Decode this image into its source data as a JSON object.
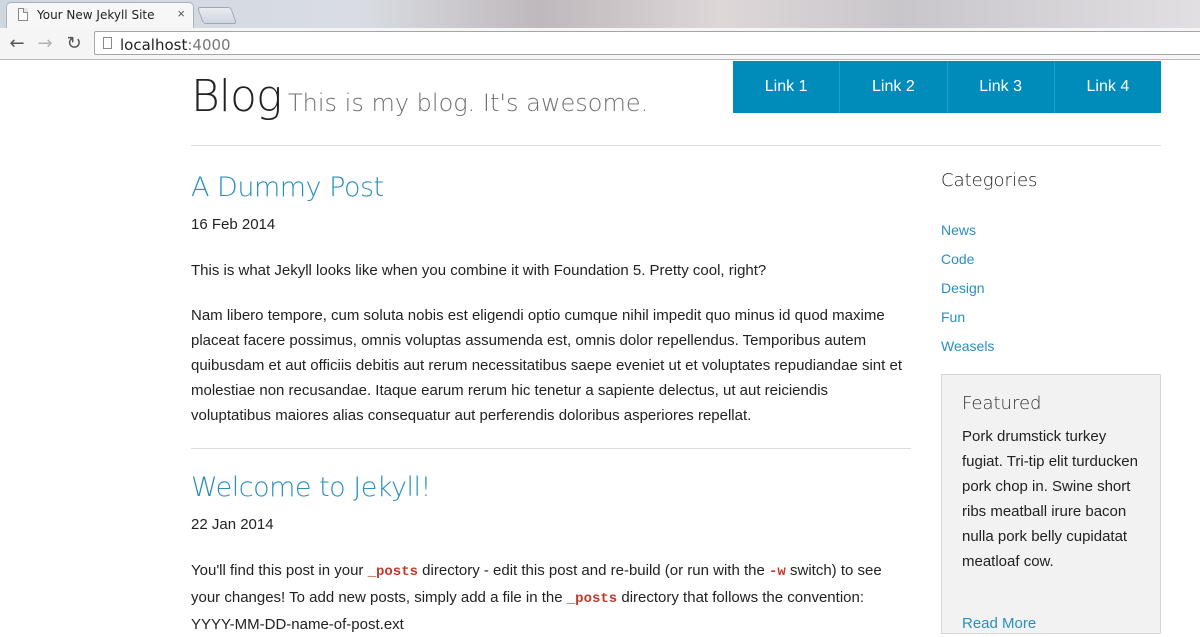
{
  "browser": {
    "tab_title": "Your New Jekyll Site",
    "tab_close": "×",
    "url_host": "localhost",
    "url_port": ":4000",
    "back": "←",
    "forward": "→",
    "reload": "↻"
  },
  "header": {
    "site_title": "Blog",
    "tagline": "This is my blog. It's awesome.",
    "nav": [
      "Link 1",
      "Link 2",
      "Link 3",
      "Link 4"
    ]
  },
  "posts": [
    {
      "title": "A Dummy Post",
      "date": "16 Feb 2014",
      "intro": "This is what Jekyll looks like when you combine it with Foundation 5. Pretty cool, right?",
      "body": "Nam libero tempore, cum soluta nobis est eligendi optio cumque nihil impedit quo minus id quod maxime placeat facere possimus, omnis voluptas assumenda est, omnis dolor repellendus. Temporibus autem quibusdam et aut officiis debitis aut rerum necessitatibus saepe eveniet ut et voluptates repudiandae sint et molestiae non recusandae. Itaque earum rerum hic tenetur a sapiente delectus, ut aut reiciendis voluptatibus maiores alias consequatur aut perferendis doloribus asperiores repellat."
    },
    {
      "title": "Welcome to Jekyll!",
      "date": "22 Jan 2014",
      "p1": "You'll find this post in your ",
      "code1": "_posts",
      "p2": " directory - edit this post and re-build (or run with the ",
      "code2": "-w",
      "p3": " switch) to see your changes! To add new posts, simply add a file in the ",
      "code3": "_posts",
      "p4": " directory that follows the convention: YYYY-MM-DD-name-of-post.ext"
    }
  ],
  "sidebar": {
    "heading": "Categories",
    "categories": [
      "News",
      "Code",
      "Design",
      "Fun",
      "Weasels"
    ],
    "featured": {
      "heading": "Featured",
      "text": "Pork drumstick turkey fugiat. Tri-tip elit turducken pork chop in. Swine short ribs meatball irure bacon nulla pork belly cupidatat meatloaf cow.",
      "link": "Read More"
    }
  }
}
